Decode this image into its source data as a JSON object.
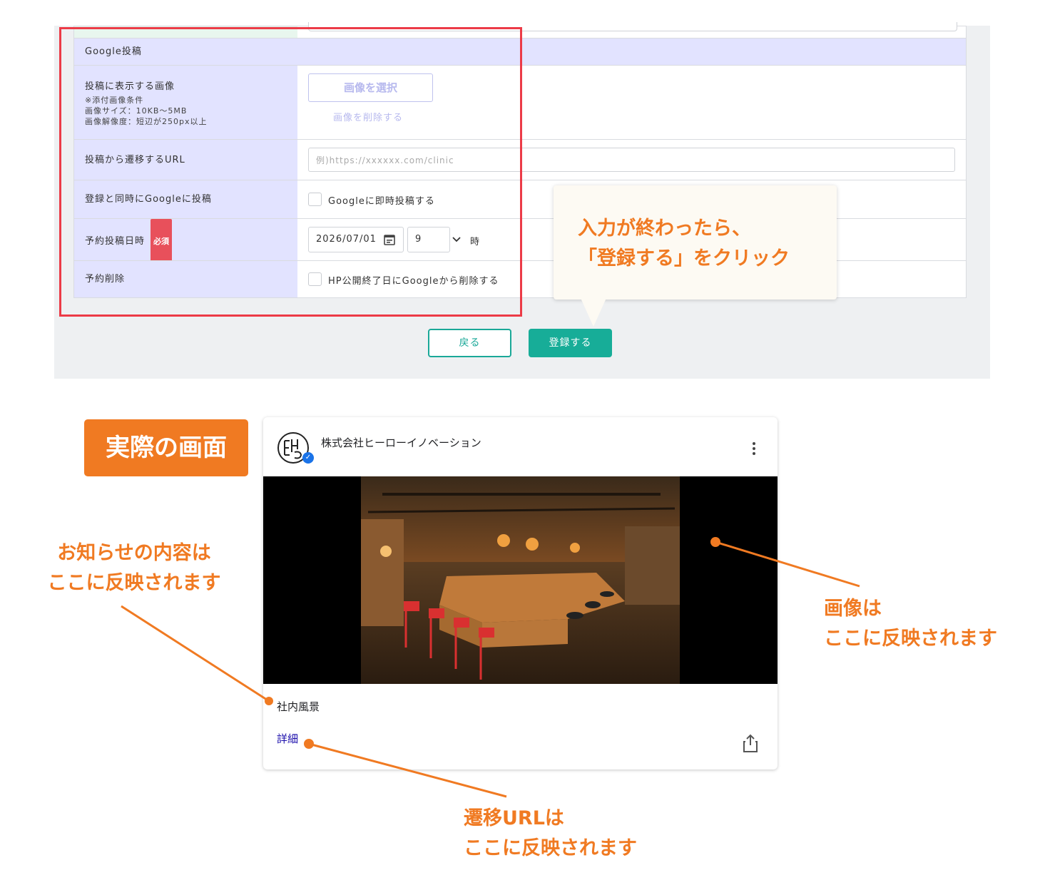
{
  "form": {
    "section_title": "Google投稿",
    "image_row": {
      "label": "投稿に表示する画像",
      "note_title": "※添付画像条件",
      "note_size": "画像サイズ：10KB〜5MB",
      "note_resolution": "画像解像度：短辺が250px以上",
      "select_button": "画像を選択",
      "delete_link": "画像を削除する"
    },
    "url_row": {
      "label": "投稿から遷移するURL",
      "placeholder": "例)https://xxxxxx.com/clinic"
    },
    "post_now_row": {
      "label": "登録と同時にGoogleに投稿",
      "checkbox_label": "Googleに即時投稿する"
    },
    "schedule_row": {
      "label": "予約投稿日時",
      "required_badge": "必須",
      "date_value": "2026/07/01",
      "hour_value": "9",
      "hour_unit": "時"
    },
    "delete_row": {
      "label": "予約削除",
      "checkbox_label": "HP公開終了日にGoogleから削除する"
    },
    "back_button": "戻る",
    "register_button": "登録する"
  },
  "tooltip": {
    "line1": "入力が終わったら、",
    "line2": "「登録する」をクリック"
  },
  "real_screen_badge": "実際の画面",
  "post_card": {
    "company_name": "株式会社ヒーローイノベーション",
    "post_text": "社内風景",
    "detail_link": "詳細"
  },
  "annotations": {
    "content_line1": "お知らせの内容は",
    "content_line2": "ここに反映されます",
    "image_line1": "画像は",
    "image_line2": "ここに反映されます",
    "url_line1": "遷移URLは",
    "url_line2": "ここに反映されます"
  },
  "colors": {
    "accent_orange": "#f07a22",
    "teal_button": "#17ad98",
    "highlight_red": "#ec3b47",
    "label_bg": "#e2e3ff"
  }
}
